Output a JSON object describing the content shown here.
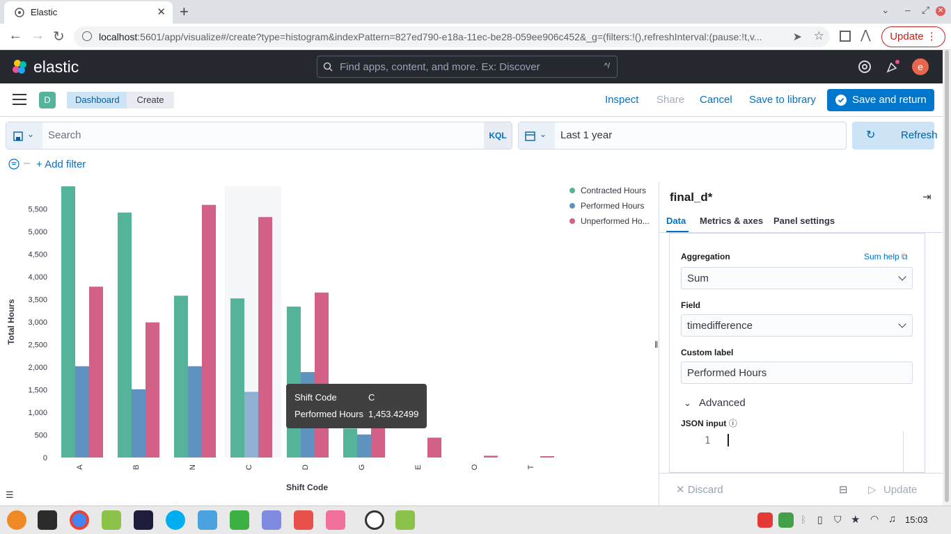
{
  "browser": {
    "tab_title": "Elastic",
    "url_host": "localhost",
    "url_rest": ":5601/app/visualize#/create?type=histogram&indexPattern=827ed790-e18a-11ec-be28-059ee906c452&_g=(filters:!(),refreshInterval:(pause:!t,v...",
    "update_label": "Update"
  },
  "kibana": {
    "brand": "elastic",
    "search_placeholder": "Find apps, content, and more. Ex: Discover",
    "search_shortcut": "^/",
    "avatar_letter": "e",
    "space_letter": "D",
    "breadcrumbs": [
      "Dashboard",
      "Create"
    ],
    "actions": {
      "inspect": "Inspect",
      "share": "Share",
      "cancel": "Cancel",
      "save_library": "Save to library",
      "save_return": "Save and return"
    }
  },
  "query": {
    "search_placeholder": "Search",
    "language": "KQL",
    "time_range": "Last 1 year",
    "refresh_label": "Refresh",
    "add_filter": "+ Add filter"
  },
  "chart_data": {
    "type": "bar",
    "xlabel": "Shift Code",
    "ylabel": "Total Hours",
    "ylim": [
      0,
      6000
    ],
    "yticks": [
      0,
      500,
      1000,
      1500,
      2000,
      2500,
      3000,
      3500,
      4000,
      4500,
      5000,
      5500
    ],
    "ytick_labels": [
      "0",
      "500",
      "1,000",
      "1,500",
      "2,000",
      "2,500",
      "3,000",
      "3,500",
      "4,000",
      "4,500",
      "5,000",
      "5,500"
    ],
    "categories": [
      "A",
      "B",
      "N",
      "C",
      "D",
      "G",
      "E",
      "O",
      "T"
    ],
    "series": [
      {
        "name": "Contracted Hours",
        "color": "#54b399",
        "values": [
          6000,
          5420,
          3580,
          3520,
          3340,
          640,
          0,
          0,
          0
        ]
      },
      {
        "name": "Performed Hours",
        "color": "#6092c0",
        "values": [
          2020,
          1510,
          2020,
          1453.42,
          1890,
          510,
          0,
          0,
          0
        ]
      },
      {
        "name": "Unperformed Ho...",
        "color": "#d36086",
        "values": [
          3780,
          2990,
          5590,
          5320,
          3650,
          680,
          440,
          40,
          30
        ]
      }
    ],
    "legend_position": "top-right",
    "highlighted_category": "C"
  },
  "tooltip": {
    "row1_label": "Shift Code",
    "row1_value": "C",
    "row2_label": "Performed Hours",
    "row2_value": "1,453.42499"
  },
  "panel": {
    "title": "final_d*",
    "tabs": [
      "Data",
      "Metrics & axes",
      "Panel settings"
    ],
    "aggregation_label": "Aggregation",
    "aggregation_help": "Sum help",
    "aggregation_value": "Sum",
    "field_label": "Field",
    "field_value": "timedifference",
    "custom_label_label": "Custom label",
    "custom_label_value": "Performed Hours",
    "advanced_label": "Advanced",
    "json_input_label": "JSON input",
    "json_line": "1",
    "discard_label": "Discard",
    "update_label": "Update"
  },
  "taskbar": {
    "clock": "15:03"
  }
}
